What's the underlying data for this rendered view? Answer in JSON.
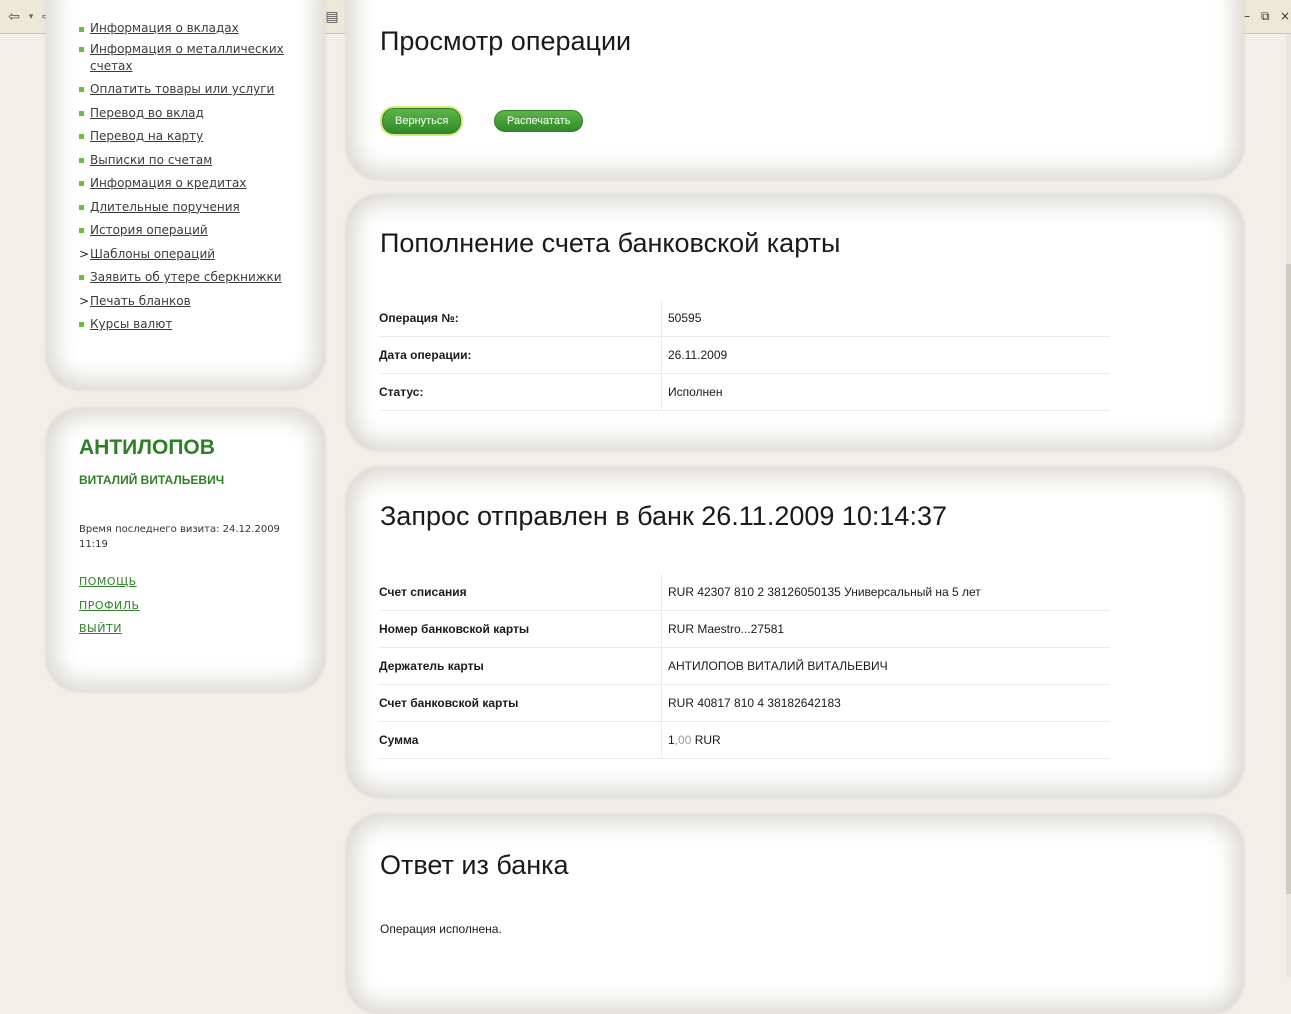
{
  "toolbar": {
    "icons": [
      "back-icon",
      "dropdown-icon",
      "forward-icon",
      "dropdown-icon",
      "stop-icon",
      "refresh-icon",
      "home-icon",
      "search-icon",
      "favorites-icon",
      "media-icon",
      "history-icon",
      "mail-icon",
      "print-icon",
      "edit-icon",
      "discuss-icon",
      "messenger-icon"
    ]
  },
  "sidebar": {
    "items": [
      {
        "label": "Информация о вкладах",
        "marker": "bullet"
      },
      {
        "label": "Информация о металлических счетах",
        "marker": "bullet"
      },
      {
        "label": "Оплатить товары или услуги",
        "marker": "bullet"
      },
      {
        "label": "Перевод во вклад",
        "marker": "bullet"
      },
      {
        "label": "Перевод на карту",
        "marker": "bullet"
      },
      {
        "label": "Выписки по счетам",
        "marker": "bullet"
      },
      {
        "label": "Информация о кредитах",
        "marker": "bullet"
      },
      {
        "label": "Длительные поручения",
        "marker": "bullet"
      },
      {
        "label": "История операций",
        "marker": "bullet"
      },
      {
        "label": "Шаблоны операций",
        "marker": ">"
      },
      {
        "label": "Заявить об утере сберкнижки",
        "marker": "bullet"
      },
      {
        "label": "Печать бланков",
        "marker": ">"
      },
      {
        "label": "Курсы валют",
        "marker": "bullet"
      }
    ],
    "arrow_symbol": ">"
  },
  "user": {
    "surname": "АНТИЛОПОВ",
    "name": "ВИТАЛИЙ ВИТАЛЬЕВИЧ",
    "last_visit": "Время последнего визита: 24.12.2009 11:19",
    "links": {
      "help": "ПОМОЩЬ",
      "profile": "ПРОФИЛЬ",
      "logout": "ВЫЙТИ"
    }
  },
  "main": {
    "title": "Просмотр операции",
    "back_label": "Вернуться",
    "print_label": "Распечатать",
    "operation": {
      "title": "Пополнение счета банковской карты",
      "rows": [
        {
          "key": "Операция №:",
          "value": "50595"
        },
        {
          "key": "Дата операции:",
          "value": "26.11.2009"
        },
        {
          "key": "Статус:",
          "value": "Исполнен"
        }
      ]
    },
    "request": {
      "title": "Запрос отправлен в банк 26.11.2009 10:14:37",
      "rows": [
        {
          "key": "Счет списания",
          "value": "RUR 42307 810 2 38126050135 Универсальный на 5 лет"
        },
        {
          "key": "Номер банковской карты",
          "value": "RUR Maestro...27581"
        },
        {
          "key": "Держатель карты",
          "value": "АНТИЛОПОВ ВИТАЛИЙ ВИТАЛЬЕВИЧ"
        },
        {
          "key": "Счет банковской карты",
          "value": "RUR 40817 810 4 38182642183"
        }
      ],
      "amount_key": "Сумма",
      "amount_int": "1",
      "amount_cents": ",00",
      "amount_currency": " RUR"
    },
    "answer": {
      "title": "Ответ из банка",
      "text": "Операция исполнена."
    }
  },
  "colors": {
    "accent_green": "#2f7f26",
    "bullet_green": "#6cbf3e",
    "panel_bg": "#ffffff",
    "page_bg": "#f1efe9"
  }
}
